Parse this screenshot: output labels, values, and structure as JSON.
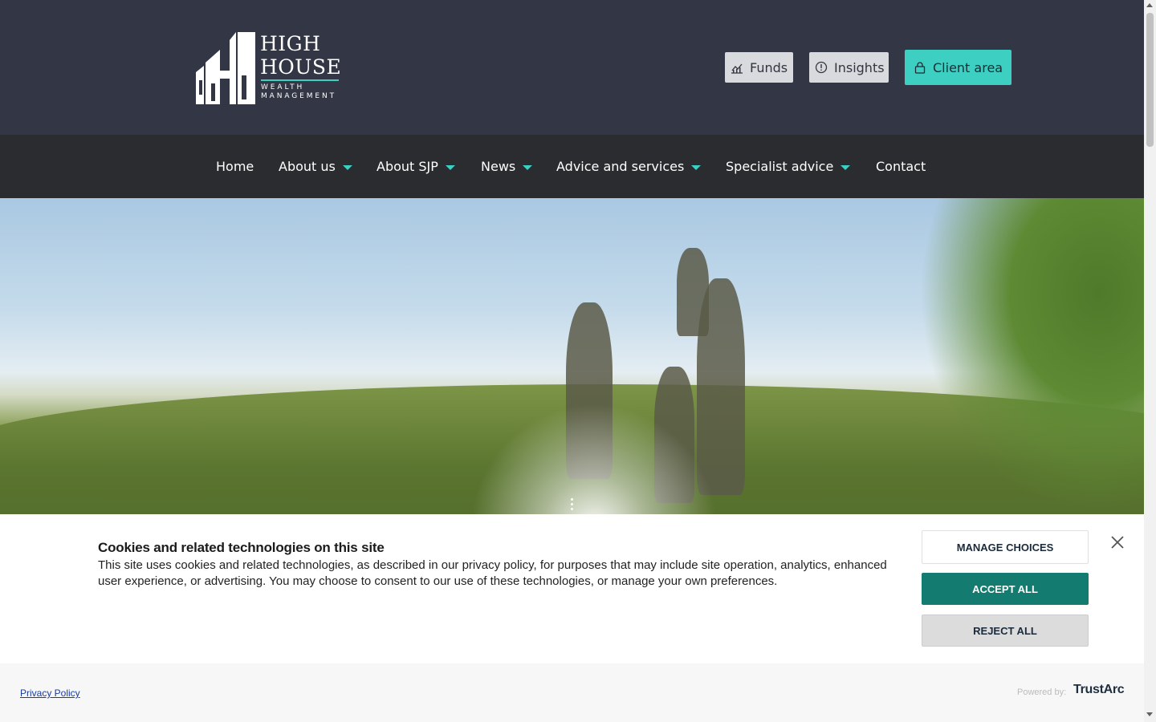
{
  "brand": {
    "line1": "HIGH",
    "line2": "HOUSE",
    "line3": "WEALTH",
    "line4": "MANAGEMENT",
    "accent_color": "#3dd0c2",
    "header_bg": "#323645",
    "nav_bg": "#2a2c2f"
  },
  "header_buttons": {
    "funds": {
      "label": "Funds",
      "icon": "chart-icon"
    },
    "insights": {
      "label": "Insights",
      "icon": "info-icon"
    },
    "client": {
      "label": "Client area",
      "icon": "lock-icon"
    }
  },
  "nav": {
    "items": [
      {
        "label": "Home",
        "dropdown": false
      },
      {
        "label": "About us",
        "dropdown": true
      },
      {
        "label": "About SJP",
        "dropdown": true
      },
      {
        "label": "News",
        "dropdown": true
      },
      {
        "label": "Advice and services",
        "dropdown": true
      },
      {
        "label": "Specialist advice",
        "dropdown": true
      },
      {
        "label": "Contact",
        "dropdown": false
      }
    ]
  },
  "cookie": {
    "title": "Cookies and related technologies on this site",
    "body": "This site uses cookies and related technologies, as described in our privacy policy, for purposes that may include site operation, analytics, enhanced user experience, or advertising. You may choose to consent to our use of these technologies, or manage your own preferences.",
    "manage_label": "MANAGE CHOICES",
    "accept_label": "ACCEPT ALL",
    "reject_label": "REJECT ALL",
    "accept_color": "#137b6f",
    "privacy_link": "Privacy Policy",
    "powered_by": "Powered by:",
    "provider": "TrustArc"
  }
}
